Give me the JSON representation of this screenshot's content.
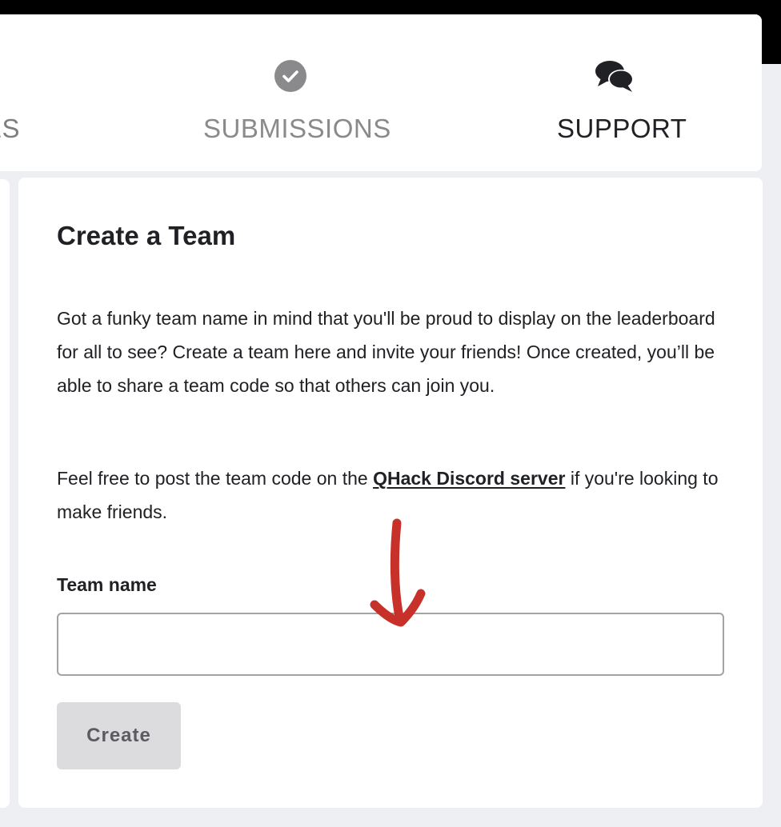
{
  "nav": {
    "items": [
      {
        "label": "ES"
      },
      {
        "label": "SUBMISSIONS",
        "icon": "check-circle-icon"
      },
      {
        "label": "SUPPORT",
        "icon": "chat-bubbles-icon"
      }
    ]
  },
  "card": {
    "title": "Create a Team",
    "paragraph1": "Got a funky team name in mind that you'll be proud to display on the leaderboard for all to see? Create a team here and invite your friends! Once created, you’ll be able to share a team code so that others can join you.",
    "paragraph2": {
      "before": "Feel free to post the team code on the ",
      "link": "QHack Discord server",
      "after": " if you're looking to make friends."
    },
    "field_label": "Team name",
    "team_name_value": "",
    "create_button": "Create"
  },
  "colors": {
    "page_background": "#eeeff3",
    "card_background": "#ffffff",
    "active_nav_text": "#202124",
    "inactive_nav_text": "#8a8a8c",
    "button_disabled_bg": "#dcdcdf",
    "annotation_arrow": "#c8302a"
  }
}
